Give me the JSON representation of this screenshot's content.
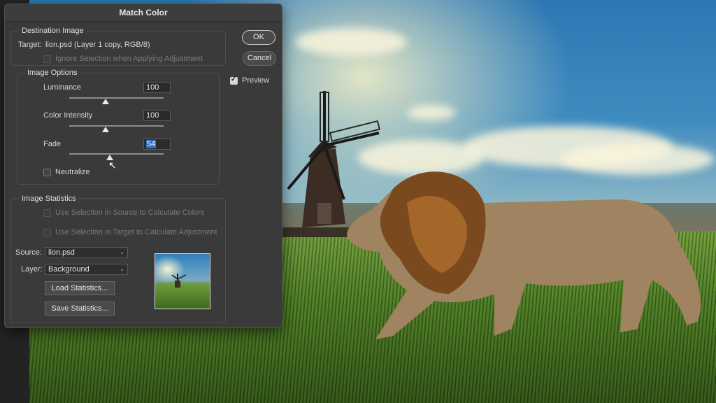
{
  "dialog": {
    "title": "Match Color",
    "destination": {
      "group_label": "Destination Image",
      "target_label": "Target:",
      "target_value": "lion.psd (Layer 1 copy, RGB/8)",
      "ignore_selection": "Ignore Selection when Applying Adjustment"
    },
    "image_options": {
      "group_label": "Image Options",
      "luminance": {
        "label": "Luminance",
        "value": "100"
      },
      "color_intensity": {
        "label": "Color Intensity",
        "value": "100"
      },
      "fade": {
        "label": "Fade",
        "value": "54"
      },
      "neutralize": "Neutralize"
    },
    "image_statistics": {
      "group_label": "Image Statistics",
      "use_source": "Use Selection in Source to Calculate Colors",
      "use_target": "Use Selection in Target to Calculate Adjustment",
      "source_label": "Source:",
      "source_value": "lion.psd",
      "layer_label": "Layer:",
      "layer_value": "Background",
      "load_button": "Load Statistics...",
      "save_button": "Save Statistics..."
    },
    "ok_button": "OK",
    "cancel_button": "Cancel",
    "preview_label": "Preview",
    "preview_checked": true
  }
}
